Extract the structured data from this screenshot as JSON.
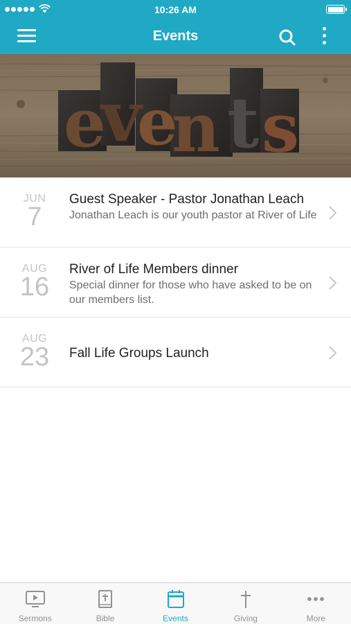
{
  "status_bar": {
    "time": "10:26 AM"
  },
  "nav": {
    "title": "Events"
  },
  "hero": {
    "alt": "events"
  },
  "events": [
    {
      "month": "JUN",
      "day": "7",
      "title": "Guest Speaker - Pastor Jonathan Leach",
      "description": "Jonathan Leach is our youth pastor at River of Life"
    },
    {
      "month": "AUG",
      "day": "16",
      "title": "River of Life Members dinner",
      "description": "Special dinner for those who have asked to be on our members list."
    },
    {
      "month": "AUG",
      "day": "23",
      "title": "Fall Life Groups Launch",
      "description": ""
    }
  ],
  "tabs": [
    {
      "label": "Sermons",
      "icon": "tv-play-icon"
    },
    {
      "label": "Bible",
      "icon": "bible-icon"
    },
    {
      "label": "Events",
      "icon": "calendar-icon",
      "active": true
    },
    {
      "label": "Giving",
      "icon": "cross-icon"
    },
    {
      "label": "More",
      "icon": "ellipsis-icon"
    }
  ],
  "colors": {
    "accent": "#1fa9c4",
    "tab_inactive": "#929292",
    "date_gray": "#c4c4c4"
  }
}
